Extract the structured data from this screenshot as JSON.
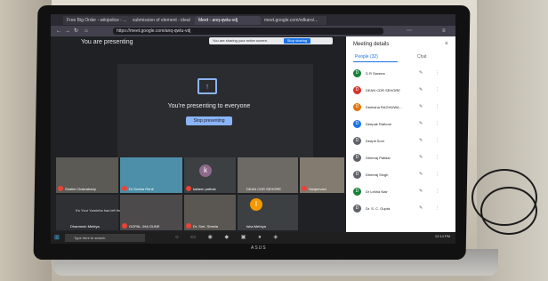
{
  "browser": {
    "tabs": [
      "Free Big Order - wikipolice - ...",
      "submission of element - ideal",
      "Meet - anq-qwtu-vdj",
      "meet.google.com/vdkaro/..."
    ],
    "url": "https://meet.google.com/anq-qwtu-vdj"
  },
  "meet": {
    "you_are_presenting": "You are presenting",
    "share_banner": "You are sharing your entire screen.",
    "share_banner_button": "Stop sharing",
    "presenting_message": "You're presenting to everyone",
    "stop_button": "Stop presenting",
    "left_meeting_msg": "It's Your Yaminha has left the meeting",
    "tiles": [
      {
        "name": "Shalini Chakrabarty"
      },
      {
        "name": "Dr Deeba Renti"
      },
      {
        "name": "kailash pathak",
        "initial": "k"
      },
      {
        "name": "DEAN CDR SEHORE"
      },
      {
        "name": "Sanjeevani"
      },
      {
        "name": "Dharmesh Mehtya"
      },
      {
        "name": "GOPAL JHA GUNE"
      },
      {
        "name": "Dr. Smt. Sheela"
      },
      {
        "name": "Isha Mehtya",
        "initial": "I"
      }
    ]
  },
  "sidebar": {
    "title": "Meeting details",
    "close": "×",
    "tab_people": "People (32)",
    "tab_chat": "Chat",
    "people": [
      {
        "name": "D R Saxena",
        "initial": "D",
        "color": "#188038"
      },
      {
        "name": "DEAN CDR SEHORE",
        "initial": "D",
        "color": "#d93025"
      },
      {
        "name": "Deeksha RAGHUWA...",
        "initial": "D",
        "color": "#e37400"
      },
      {
        "name": "Deepak Rathore",
        "initial": "D",
        "color": "#1a73e8"
      },
      {
        "name": "Deepti Soni",
        "initial": "D",
        "color": "#5f6368"
      },
      {
        "name": "Dheeraj Patidar",
        "initial": "D",
        "color": "#5f6368"
      },
      {
        "name": "Dheeraj Singh",
        "initial": "D",
        "color": "#5f6368"
      },
      {
        "name": "Dr Lekha Nair",
        "initial": "D",
        "color": "#188038"
      },
      {
        "name": "Dr. S. C. Gupta",
        "initial": "D",
        "color": "#5f6368"
      }
    ]
  },
  "taskbar": {
    "search_placeholder": "Type here to search",
    "time": "12:14 PM"
  },
  "brand": "ASUS"
}
